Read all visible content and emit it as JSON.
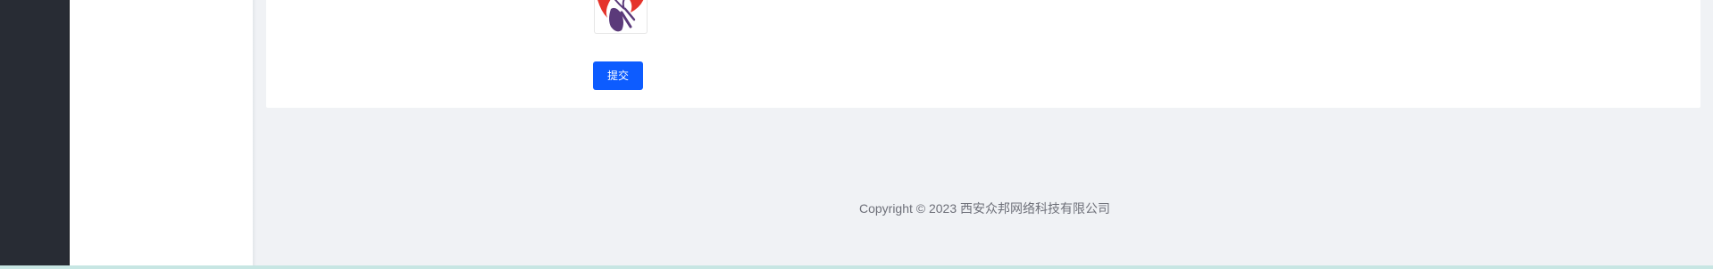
{
  "form": {
    "submit_label": "提交",
    "logo_icon": "brand-logo-icon",
    "logo_colors": [
      "#e5332a",
      "#5b3a7a"
    ]
  },
  "footer": {
    "copyright": "Copyright © 2023 西安众邦网络科技有限公司"
  },
  "colors": {
    "sidebar": "#282c34",
    "page_background": "#f0f2f5",
    "primary": "#0d5cff"
  }
}
